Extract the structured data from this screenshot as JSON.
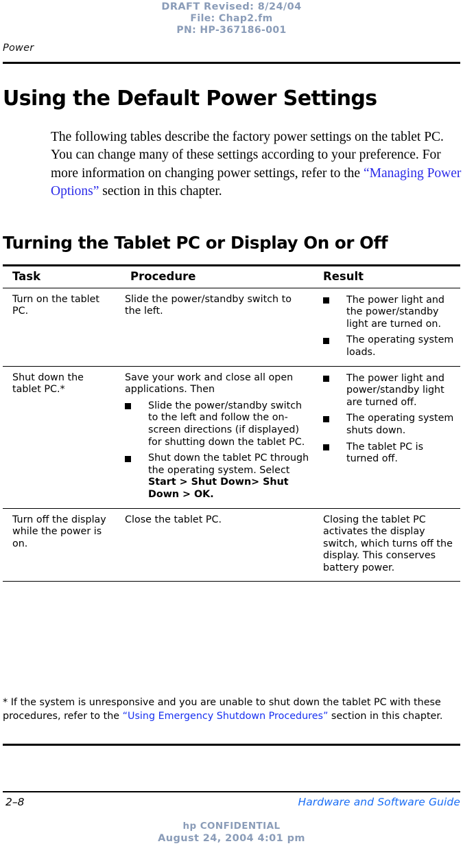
{
  "draft_stamp": {
    "revised": "DRAFT Revised: 8/24/04",
    "file": "File: Chap2.fm",
    "pn": "PN: HP-367186-001",
    "color": "#8a9cb8"
  },
  "running_header": {
    "chapter": "Power"
  },
  "page": {
    "title": "Using the Default Power Settings",
    "intro_before_link": "The following tables describe the factory power settings on the tablet PC. You can change many of these settings according to your preference. For more information on changing power settings, refer to the ",
    "intro_link_open_quote": "“",
    "intro_link": "Managing Power Options",
    "intro_link_close_quote": "”",
    "intro_after_link": " section in this chapter.",
    "section_title": "Turning the Tablet PC or Display On or Off",
    "link_color": "#2a2ae8"
  },
  "table": {
    "headers": {
      "task": "Task",
      "procedure": "Procedure",
      "result": "Result"
    },
    "rows": [
      {
        "task": "Turn on the tablet PC.",
        "procedure_lead": "Slide the power/standby switch to the left.",
        "procedure_bullets": [],
        "result_lead": "",
        "result_bullets": [
          "The power light and the power/standby light are turned on.",
          "The operating system loads."
        ]
      },
      {
        "task": "Shut down the tablet PC.*",
        "procedure_lead": "Save your work and close all open applications. Then",
        "procedure_bullets": [
          {
            "text_1": "Slide the power/standby switch to the left and follow the on-screen directions (if displayed) for shutting down the tablet PC.",
            "bold_1": "",
            "text_2": ""
          },
          {
            "text_1": "Shut down the tablet PC through the operating system. Select ",
            "bold_1": "Start > Shut Down> Shut Down > OK.",
            "text_2": ""
          }
        ],
        "result_lead": "",
        "result_bullets": [
          "The power light and power/standby light are turned off.",
          "The operating system shuts down.",
          "The tablet PC is turned off."
        ]
      },
      {
        "task": "Turn off the display while the power is on.",
        "procedure_lead": "Close the tablet PC.",
        "procedure_bullets": [],
        "result_lead": "Closing the tablet PC activates the display switch, which turns off the display. This conserves battery power.",
        "result_bullets": []
      }
    ]
  },
  "footnote": {
    "before_link": "* If the system is unresponsive and you are unable to shut down the tablet PC with these procedures, refer to the ",
    "link_open_quote": "“",
    "link": "Using Emergency Shutdown Procedures",
    "link_close_quote": "”",
    "after_link": " section in this chapter.",
    "link_color": "#1730f0"
  },
  "footer": {
    "page_number": "2–8",
    "guide_title": "Hardware and Software Guide",
    "guide_color": "#1a6ef5",
    "confidential": "hp CONFIDENTIAL",
    "timestamp": "August 24, 2004 4:01 pm"
  }
}
